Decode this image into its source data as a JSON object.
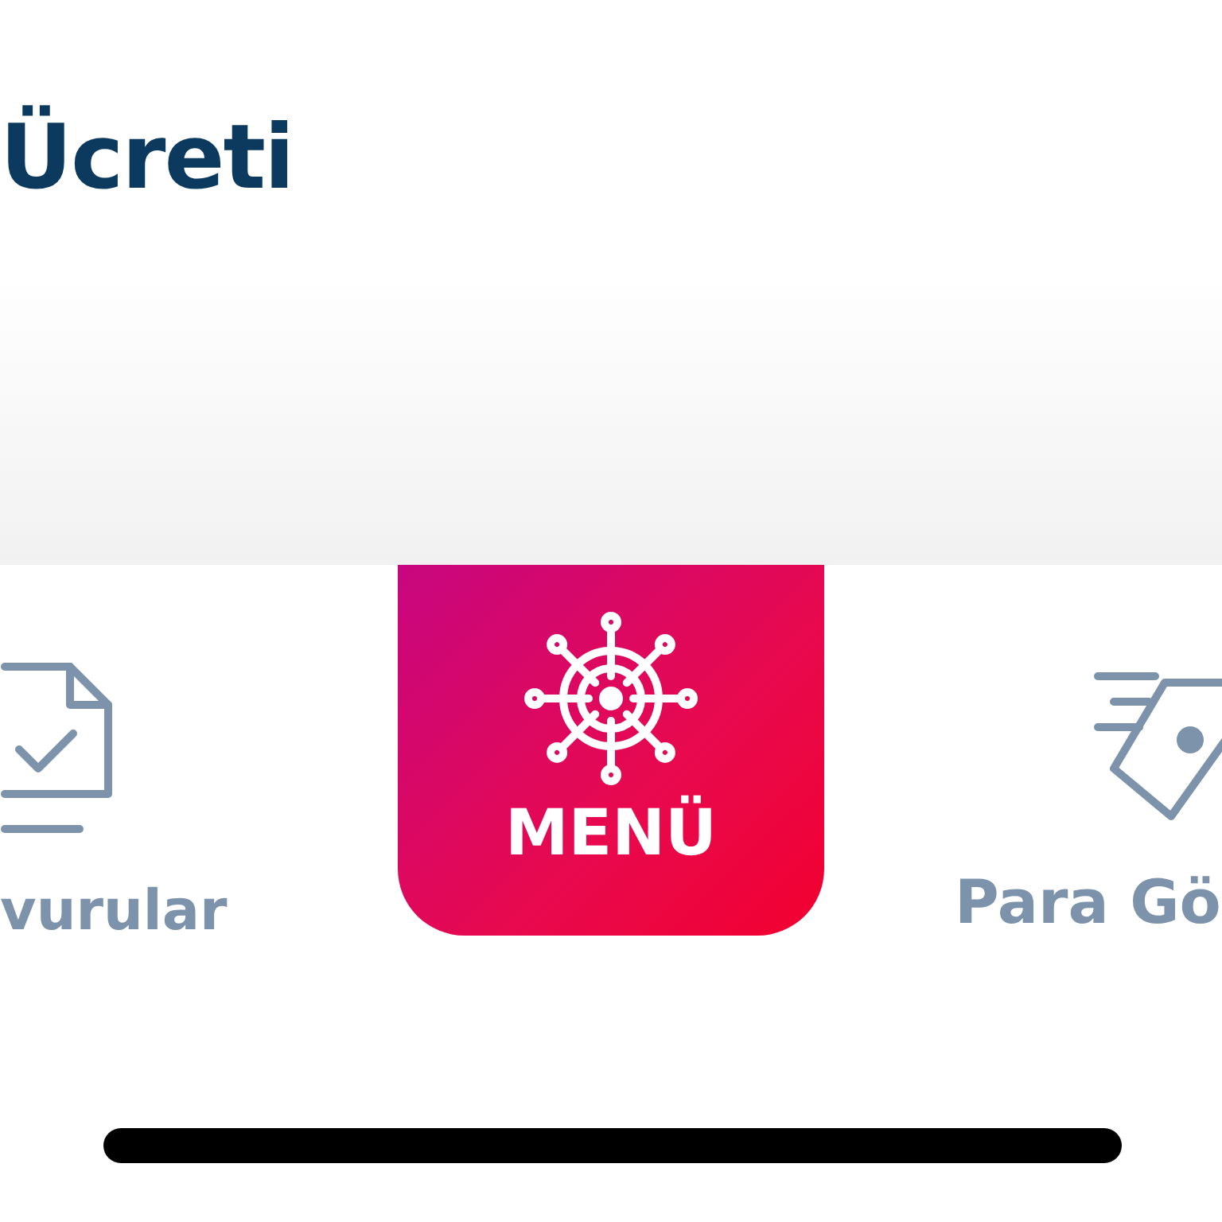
{
  "page": {
    "title": "Ücreti"
  },
  "nav": {
    "items": [
      {
        "label": "vurular",
        "kind": "applications",
        "selected": false
      },
      {
        "label": "MENÜ",
        "kind": "menu",
        "selected": true
      },
      {
        "label": "Para Gö",
        "kind": "transfer",
        "selected": false
      }
    ]
  }
}
